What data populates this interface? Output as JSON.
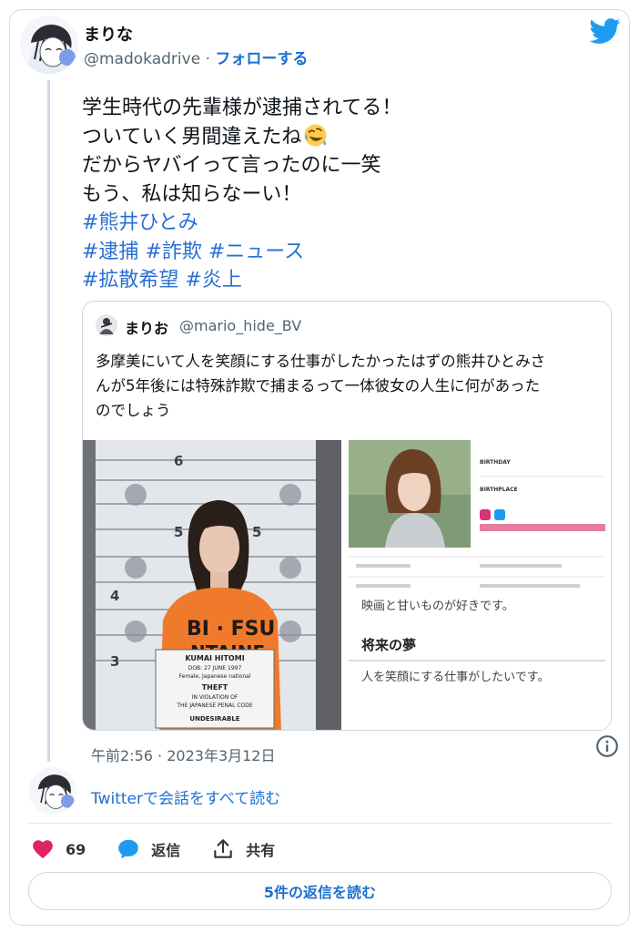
{
  "author": {
    "display_name": "まりな",
    "handle": "@madokadrive",
    "separator": "·",
    "follow_label": "フォローする"
  },
  "tweet": {
    "lines": [
      "学生時代の先輩様が逮捕されてる！",
      "ついていく男間違えたね",
      "だからヤバイって言ったのに一笑",
      "もう、私は知らなーい！"
    ],
    "hashtags": [
      "#熊井ひとみ",
      "#逮捕",
      "#詐欺",
      "#ニュース",
      "#拡散希望",
      "#炎上"
    ],
    "emoji": "rolling-on-floor-laughing"
  },
  "quoted_tweet": {
    "display_name": "まりお",
    "handle": "@mario_hide_BV",
    "lines": [
      "多摩美にいて人を笑顔にする仕事がしたかったはずの熊井ひとみさ",
      "んが5年後には特殊詐欺で捕まるって一体彼女の人生に何があった",
      "のでしょう"
    ],
    "photo1": {
      "shirt_text": "BI · FSU",
      "shirt_text2": "NTAINE",
      "placard_lines": [
        "KUMAI HITOMI",
        "DOB: 27 JUNE 1997",
        "Female, Japanese national",
        "THEFT",
        "IN VIOLATION OF",
        "THE JAPANESE PENAL CODE",
        "UNDESIRABLE"
      ],
      "height_marks": [
        "6",
        "5",
        "4",
        "3"
      ]
    },
    "photo2": {
      "profile_fields": [
        "BIRTHDAY",
        "BIRTHPLACE"
      ],
      "section_text": "映画と甘いものが好きです。",
      "section_heading": "将来の夢",
      "dream_text": "人を笑顔にする仕事がしたいです。"
    }
  },
  "meta": {
    "time": "午前2:56",
    "separator": "·",
    "date": "2023年3月12日"
  },
  "read_conversation": "Twitterで会話をすべて読む",
  "actions": {
    "like_count": "69",
    "reply_label": "返信",
    "share_label": "共有"
  },
  "more_replies_label": "5件の返信を読む",
  "colors": {
    "link_blue": "#1d6fd1",
    "hashtag_blue": "#2a6fd6",
    "like_pink": "#e0245e",
    "twitter_blue": "#1d9bf0"
  }
}
